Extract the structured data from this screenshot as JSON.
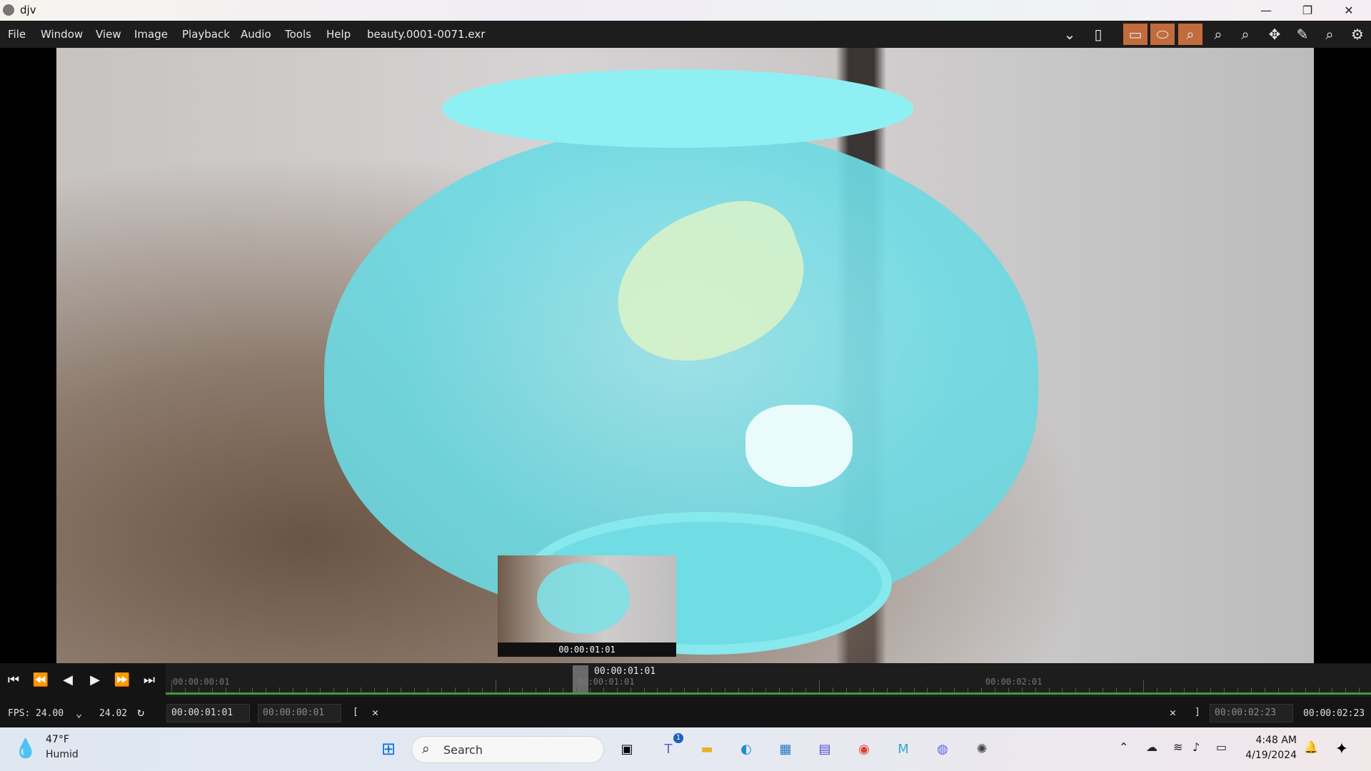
{
  "window": {
    "title": "djv",
    "minimize": "—",
    "maximize": "❐",
    "close": "✕"
  },
  "menu": {
    "items": [
      "File",
      "Window",
      "View",
      "Image",
      "Playback",
      "Audio",
      "Tools",
      "Help"
    ],
    "filename": "beauty.0001-0071.exr"
  },
  "toolbar": {
    "icons": [
      {
        "name": "dropdown-icon",
        "glyph": "⌄"
      },
      {
        "name": "memory-icon",
        "glyph": "▯"
      },
      {
        "name": "rectangle-icon",
        "glyph": "▭"
      },
      {
        "name": "ellipse-icon",
        "glyph": "⬭"
      },
      {
        "name": "zoom-fit-icon",
        "glyph": "⌕"
      },
      {
        "name": "zoom-in-icon",
        "glyph": "⌕"
      },
      {
        "name": "zoom-reset-icon",
        "glyph": "⌕"
      },
      {
        "name": "move-icon",
        "glyph": "✥"
      },
      {
        "name": "color-picker-icon",
        "glyph": "✎"
      },
      {
        "name": "search-icon",
        "glyph": "⌕"
      },
      {
        "name": "settings-icon",
        "glyph": "⚙"
      }
    ]
  },
  "viewer": {
    "thumbnail_time": "00:00:01:01"
  },
  "playback": {
    "buttons": [
      {
        "name": "go-start-icon",
        "glyph": "⏮"
      },
      {
        "name": "prev-frame-icon",
        "glyph": "⏪"
      },
      {
        "name": "reverse-icon",
        "glyph": "◀"
      },
      {
        "name": "play-icon",
        "glyph": "▶"
      },
      {
        "name": "next-frame-icon",
        "glyph": "⏩"
      },
      {
        "name": "go-end-icon",
        "glyph": "⏭"
      }
    ]
  },
  "timeline": {
    "current_time": "00:00:01:01",
    "playhead_label": "00:00:01:01",
    "start_label": "00:00:00:01",
    "mark_label": "00:00:02:01"
  },
  "status": {
    "fps_label": "FPS:",
    "fps_value": "24.00",
    "fps_actual": "24.02",
    "current_frame": "00:00:01:01",
    "in_point": "00:00:00:01",
    "in_bracket": "[",
    "out_bracket": "]",
    "out_point": "00:00:02:23",
    "duration": "00:00:02:23"
  },
  "taskbar": {
    "weather_temp": "47°F",
    "weather_desc": "Humid",
    "search_placeholder": "Search",
    "teams_badge": "1",
    "time": "4:48 AM",
    "date": "4/19/2024"
  }
}
